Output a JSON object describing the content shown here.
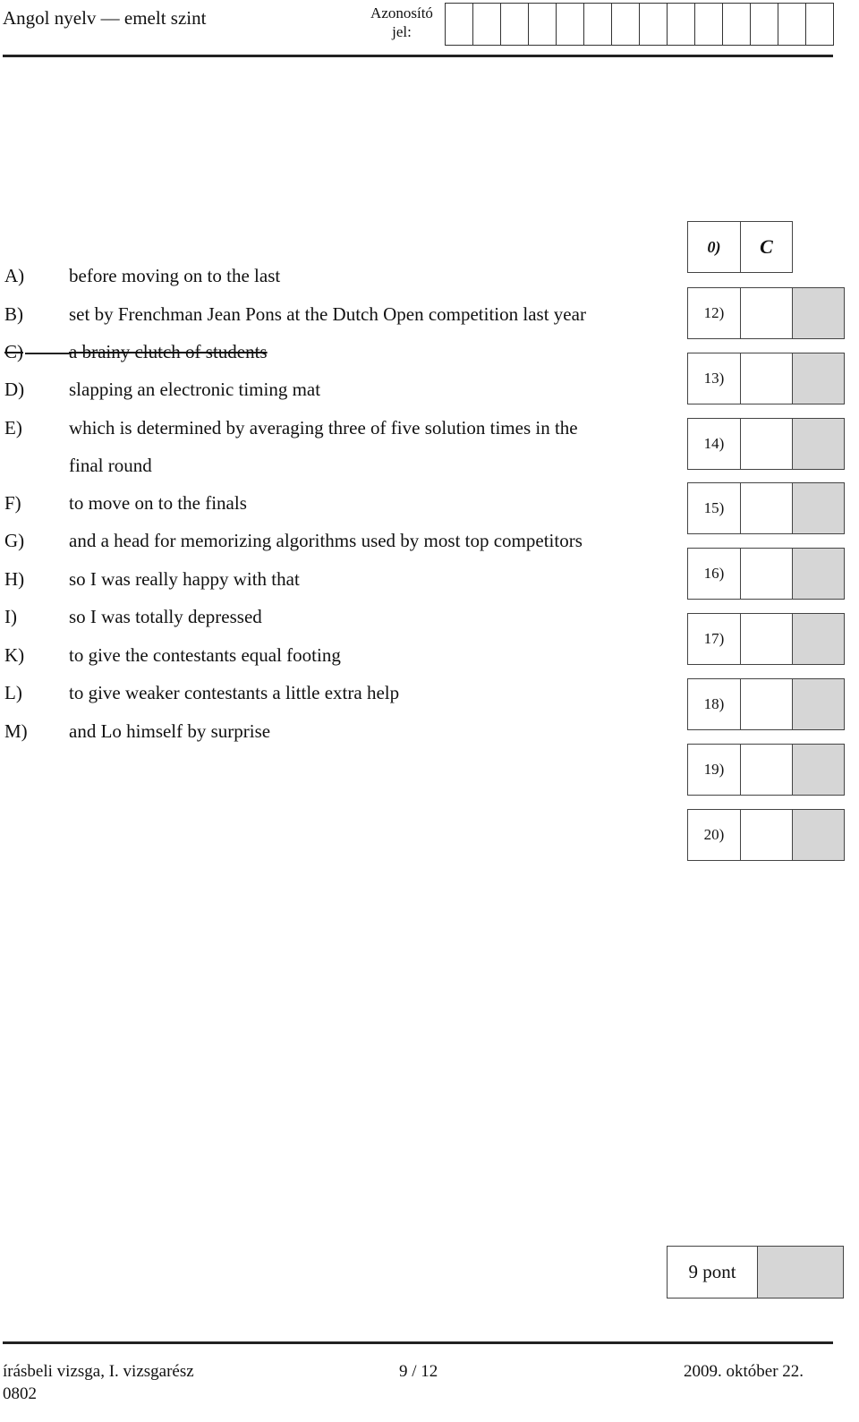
{
  "header": {
    "title": "Angol nyelv — emelt szint",
    "id_label_line1": "Azonosító",
    "id_label_line2": "jel:",
    "id_cell_count": 14
  },
  "options": [
    {
      "letter": "A)",
      "text": "before moving on to the last",
      "struck": false
    },
    {
      "letter": "B)",
      "text": "set by Frenchman Jean Pons at the Dutch Open competition last year",
      "struck": false
    },
    {
      "letter": "C)",
      "text": "a brainy clutch of students",
      "struck": true
    },
    {
      "letter": "D)",
      "text": "slapping an electronic timing mat",
      "struck": false
    },
    {
      "letter": "E)",
      "text": "which is determined by averaging three of five solution times in the",
      "continuation": "final round",
      "struck": false
    },
    {
      "letter": "F)",
      "text": "to move on to the finals",
      "struck": false
    },
    {
      "letter": "G)",
      "text": "and a head for memorizing algorithms used by most top competitors",
      "struck": false
    },
    {
      "letter": "H)",
      "text": "so I was really happy with that",
      "struck": false
    },
    {
      "letter": "I)",
      "text": "so I was totally depressed",
      "struck": false
    },
    {
      "letter": "K)",
      "text": "to give the contestants equal footing",
      "struck": false
    },
    {
      "letter": "L)",
      "text": "to give weaker contestants a little extra help",
      "struck": false
    },
    {
      "letter": "M)",
      "text": "and Lo himself by surprise",
      "struck": false
    }
  ],
  "answers": {
    "example": {
      "number": "0)",
      "answer": "C"
    },
    "items": [
      {
        "number": "12)",
        "value": ""
      },
      {
        "number": "13)",
        "value": ""
      },
      {
        "number": "14)",
        "value": ""
      },
      {
        "number": "15)",
        "value": ""
      },
      {
        "number": "16)",
        "value": ""
      },
      {
        "number": "17)",
        "value": ""
      },
      {
        "number": "18)",
        "value": ""
      },
      {
        "number": "19)",
        "value": ""
      },
      {
        "number": "20)",
        "value": ""
      }
    ]
  },
  "score": {
    "label": "9 pont",
    "value": ""
  },
  "footer": {
    "left": "írásbeli vizsga, I. vizsgarész",
    "code": "0802",
    "page": "9 / 12",
    "date": "2009. október 22."
  },
  "colors": {
    "gray_cell": "#d6d6d6",
    "border": "#444444"
  }
}
